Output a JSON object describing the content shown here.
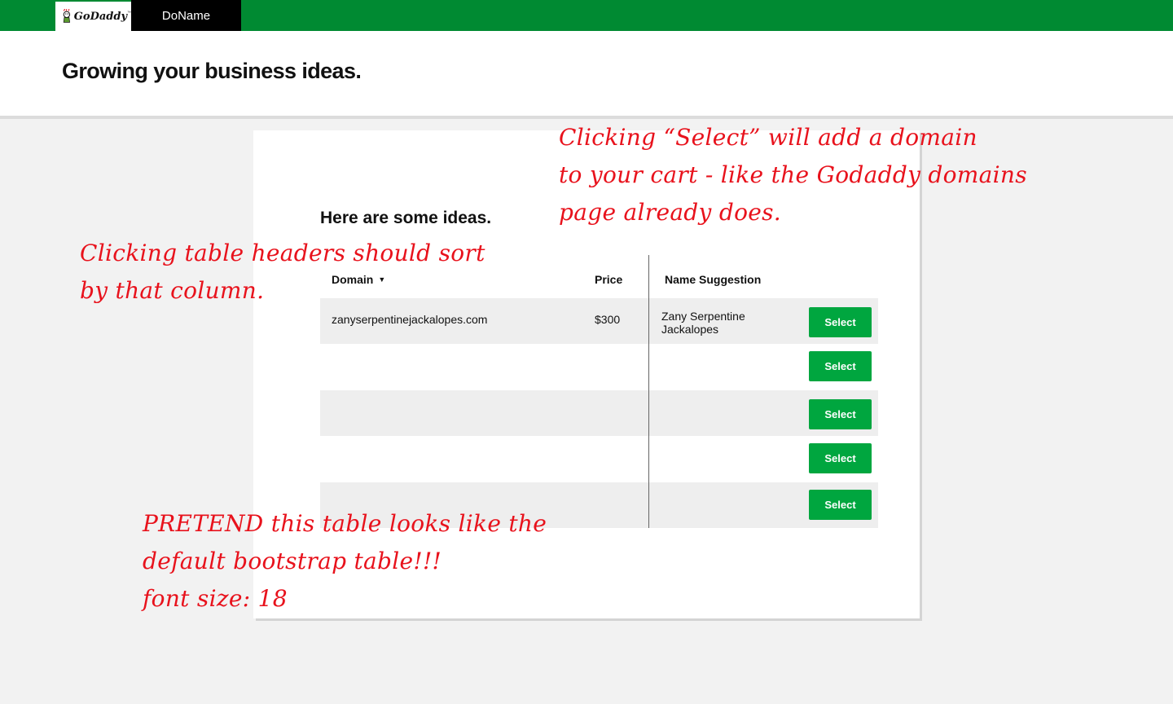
{
  "topbar": {
    "logo_text": "GoDaddy",
    "logo_tm": "™",
    "app_name": "DoName"
  },
  "header": {
    "title": "Growing your business ideas."
  },
  "ideas": {
    "heading": "Here are some ideas.",
    "columns": {
      "domain": "Domain",
      "price": "Price",
      "name_suggestion": "Name Suggestion"
    },
    "sort_indicator": "▼",
    "rows": [
      {
        "domain": "zanyserpentinejackalopes.com",
        "price": "$300",
        "name_suggestion": "Zany Serpentine Jackalopes",
        "select_label": "Select"
      },
      {
        "domain": "",
        "price": "",
        "name_suggestion": "",
        "select_label": "Select"
      },
      {
        "domain": "",
        "price": "",
        "name_suggestion": "",
        "select_label": "Select"
      },
      {
        "domain": "",
        "price": "",
        "name_suggestion": "",
        "select_label": "Select"
      },
      {
        "domain": "",
        "price": "",
        "name_suggestion": "",
        "select_label": "Select"
      }
    ]
  },
  "annotations": {
    "select_note": "Clicking “Select” will add a domain\nto your cart - like the Godaddy domains\npage already does.",
    "sort_note": "Clicking table headers should sort\nby that column.",
    "table_note": "PRETEND this table looks like the\ndefault bootstrap table!!!\nfont size: 18",
    "color": "#e8121c"
  },
  "colors": {
    "brand_green": "#008a32",
    "button_green": "#00a63f"
  }
}
